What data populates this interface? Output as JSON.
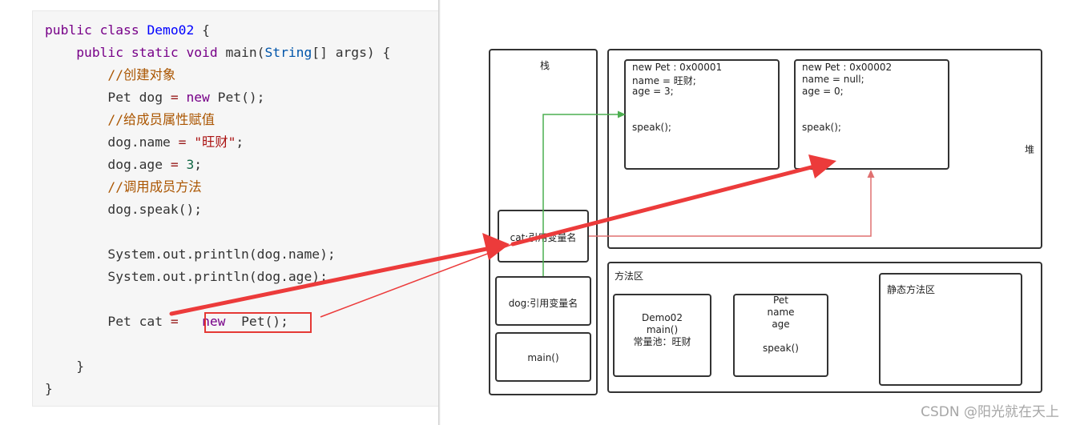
{
  "code": {
    "lines": [
      [
        {
          "t": "public class ",
          "c": "kw"
        },
        {
          "t": "Demo02",
          "c": "cls"
        },
        {
          "t": " {",
          "c": ""
        }
      ],
      [
        {
          "t": "    public static void ",
          "c": "kw"
        },
        {
          "t": "main(",
          "c": ""
        },
        {
          "t": "String",
          "c": "typ"
        },
        {
          "t": "[] args) {",
          "c": ""
        }
      ],
      [
        {
          "t": "        //创建对象",
          "c": "cm"
        }
      ],
      [
        {
          "t": "        Pet dog ",
          "c": ""
        },
        {
          "t": "= ",
          "c": "op"
        },
        {
          "t": "new ",
          "c": "kw"
        },
        {
          "t": "Pet();",
          "c": ""
        }
      ],
      [
        {
          "t": "        //给成员属性赋值",
          "c": "cm"
        }
      ],
      [
        {
          "t": "        dog.name ",
          "c": ""
        },
        {
          "t": "= ",
          "c": "op"
        },
        {
          "t": "\"旺财\"",
          "c": "str"
        },
        {
          "t": ";",
          "c": ""
        }
      ],
      [
        {
          "t": "        dog.age ",
          "c": ""
        },
        {
          "t": "= ",
          "c": "op"
        },
        {
          "t": "3",
          "c": "num"
        },
        {
          "t": ";",
          "c": ""
        }
      ],
      [
        {
          "t": "        //调用成员方法",
          "c": "cm"
        }
      ],
      [
        {
          "t": "        dog.speak();",
          "c": ""
        }
      ],
      [
        {
          "t": "",
          "c": ""
        }
      ],
      [
        {
          "t": "        System.out.println(dog.name);",
          "c": ""
        }
      ],
      [
        {
          "t": "        System.out.println(dog.age);",
          "c": ""
        }
      ],
      [
        {
          "t": "",
          "c": ""
        }
      ],
      [
        {
          "t": "        Pet cat ",
          "c": ""
        },
        {
          "t": "=  ",
          "c": "op"
        },
        {
          "t": " new ",
          "c": "kw"
        },
        {
          "t": " Pet();",
          "c": ""
        }
      ],
      [
        {
          "t": "",
          "c": ""
        }
      ],
      [
        {
          "t": "    }",
          "c": ""
        }
      ],
      [
        {
          "t": "}",
          "c": ""
        }
      ]
    ]
  },
  "stack": {
    "title": "栈",
    "cat_ref": "cat:引用变量名",
    "dog_ref": "dog:引用变量名",
    "main_frame": "main()"
  },
  "heap": {
    "title": "堆",
    "obj1": {
      "header": "new Pet : 0x00001",
      "name_line": "name = 旺财;",
      "age_line": "age = 3;",
      "method": "speak();"
    },
    "obj2": {
      "header": "new Pet : 0x00002",
      "name_line": "name = null;",
      "age_line": "age = 0;",
      "method": "speak();"
    }
  },
  "method_area": {
    "title": "方法区",
    "demo_box": "Demo02\nmain()\n常量池：旺财",
    "pet_box": "Pet\nname\nage\n\nspeak()",
    "static_box": "静态方法区"
  },
  "colors": {
    "green_arrow": "#4caf50",
    "red_arrow": "#e53935",
    "pink_arrow": "#e07070"
  },
  "watermark": "CSDN @阳光就在天上"
}
